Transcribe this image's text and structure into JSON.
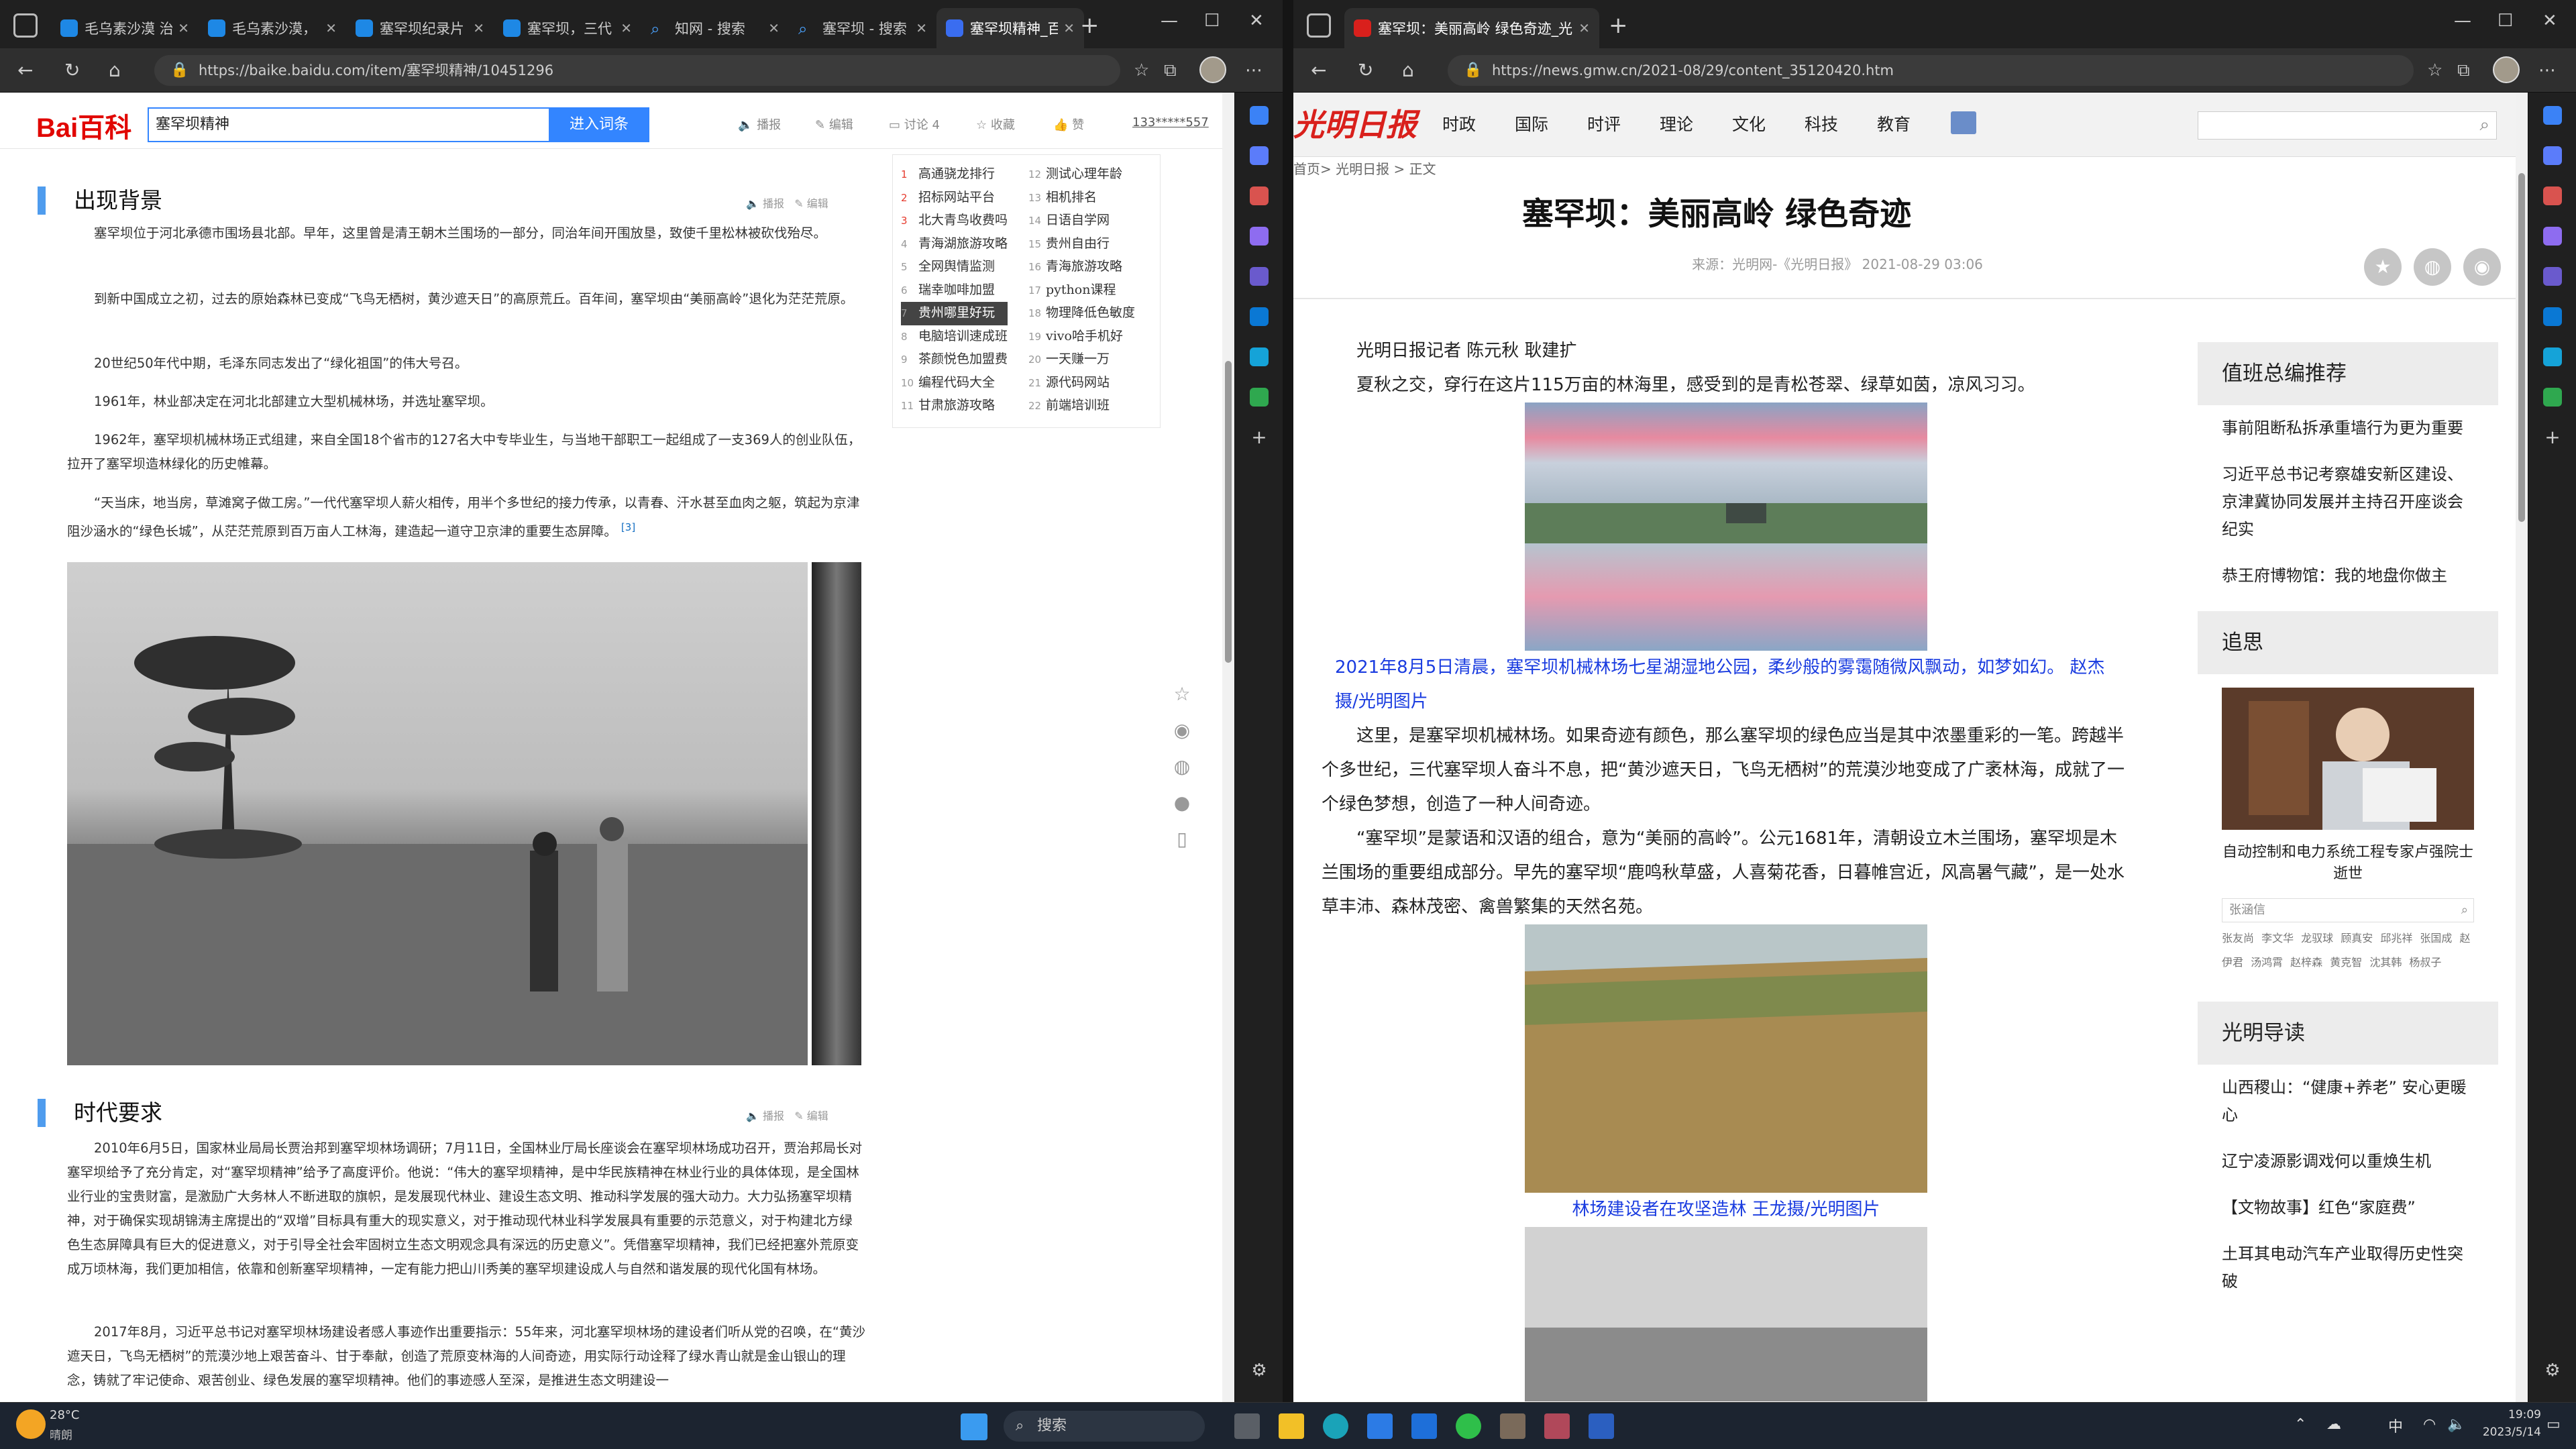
{
  "left": {
    "tabs": [
      "毛乌素沙漠 治",
      "毛乌素沙漠，",
      "塞罕坝纪录片",
      "塞罕坝，三代",
      "知网 - 搜索",
      "塞罕坝 - 搜索",
      "塞罕坝精神_百"
    ],
    "url": "https://baike.baidu.com/item/塞罕坝精神/10451296",
    "logo": "Bai百科",
    "search_value": "塞罕坝精神",
    "enter_button": "进入词条",
    "tools": [
      "播报",
      "编辑",
      "讨论 4",
      "收藏",
      "赞",
      "133*****557"
    ],
    "sec1_title": "出现背景",
    "sec_tool_a": "播报",
    "sec_tool_b": "编辑",
    "p1": "塞罕坝位于河北承德市围场县北部。早年，这里曾是清王朝木兰围场的一部分，同治年间开围放垦，致使千里松林被砍伐殆尽。",
    "p2": "到新中国成立之初，过去的原始森林已变成“飞鸟无栖树，黄沙遮天日”的高原荒丘。百年间，塞罕坝由“美丽高岭”退化为茫茫荒原。",
    "p3": "20世纪50年代中期，毛泽东同志发出了“绿化祖国”的伟大号召。",
    "p4": "1961年，林业部决定在河北北部建立大型机械林场，并选址塞罕坝。",
    "p5": "1962年，塞罕坝机械林场正式组建，来自全国18个省市的127名大中专毕业生，与当地干部职工一起组成了一支369人的创业队伍，拉开了塞罕坝造林绿化的历史帷幕。",
    "p6": "“天当床，地当房，草滩窝子做工房。”一代代塞罕坝人薪火相传，用半个多世纪的接力传承，以青春、汗水甚至血肉之躯，筑起为京津阻沙涵水的“绿色长城”，从茫茫荒原到百万亩人工林海，建造起一道守卫京津的重要生态屏障。",
    "ref": "[3]",
    "sec2_title": "时代要求",
    "p7": "2010年6月5日，国家林业局局长贾治邦到塞罕坝林场调研；7月11日，全国林业厅局长座谈会在塞罕坝林场成功召开，贾治邦局长对塞罕坝给予了充分肯定，对“塞罕坝精神”给予了高度评价。他说：“伟大的塞罕坝精神，是中华民族精神在林业行业的具体体现，是全国林业行业的宝贵财富，是激励广大务林人不断进取的旗帜，是发展现代林业、建设生态文明、推动科学发展的强大动力。大力弘扬塞罕坝精神，对于确保实现胡锦涛主席提出的“双增”目标具有重大的现实意义，对于推动现代林业科学发展具有重要的示范意义，对于构建北方绿色生态屏障具有巨大的促进意义，对于引导全社会牢固树立生态文明观念具有深远的历史意义”。凭借塞罕坝精神，我们已经把塞外荒原变成万顷林海，我们更加相信，依靠和创新塞罕坝精神，一定有能力把山川秀美的塞罕坝建设成人与自然和谐发展的现代化国有林场。",
    "p8": "2017年8月，习近平总书记对塞罕坝林场建设者感人事迹作出重要指示：55年来，河北塞罕坝林场的建设者们听从党的召唤，在“黄沙遮天日，飞鸟无栖树”的荒漠沙地上艰苦奋斗、甘于奉献，创造了荒原变林海的人间奇迹，用实际行动诠释了绿水青山就是金山银山的理念，铸就了牢记使命、艰苦创业、绿色发展的塞罕坝精神。他们的事迹感人至深，是推进生态文明建设一",
    "rank_left": [
      [
        "1",
        "高通骁龙排行"
      ],
      [
        "2",
        "招标网站平台"
      ],
      [
        "3",
        "北大青鸟收费吗"
      ],
      [
        "4",
        "青海湖旅游攻略"
      ],
      [
        "5",
        "全网舆情监测"
      ],
      [
        "6",
        "瑞幸咖啡加盟"
      ],
      [
        "7",
        "贵州哪里好玩"
      ],
      [
        "8",
        "电脑培训速成班"
      ],
      [
        "9",
        "茶颜悦色加盟费"
      ],
      [
        "10",
        "编程代码大全"
      ],
      [
        "11",
        "甘肃旅游攻略"
      ]
    ],
    "rank_right": [
      [
        "12",
        "测试心理年龄"
      ],
      [
        "13",
        "相机排名"
      ],
      [
        "14",
        "日语自学网"
      ],
      [
        "15",
        "贵州自由行"
      ],
      [
        "16",
        "青海旅游攻略"
      ],
      [
        "17",
        "python课程"
      ],
      [
        "18",
        "物理降低色敏度"
      ],
      [
        "19",
        "vivo哈手机好"
      ],
      [
        "20",
        "一天赚一万"
      ],
      [
        "21",
        "源代码网站"
      ],
      [
        "22",
        "前端培训班"
      ]
    ]
  },
  "right": {
    "tab": "塞罕坝：美丽高岭 绿色奇迹_光",
    "url": "https://news.gmw.cn/2021-08/29/content_35120420.htm",
    "logo": "光明日报",
    "nav": [
      "时政",
      "国际",
      "时评",
      "理论",
      "文化",
      "科技",
      "教育"
    ],
    "crumb": "首页> 光明日报 > 正文",
    "title": "塞罕坝：美丽高岭 绿色奇迹",
    "meta": "来源：光明网-《光明日报》   2021-08-29 03:06",
    "byline": "光明日报记者 陈元秋 耿建扩",
    "lead": "夏秋之交，穿行在这片115万亩的林海里，感受到的是青松苍翠、绿草如茵，凉风习习。",
    "cap1": "2021年8月5日清晨，塞罕坝机械林场七星湖湿地公园，柔纱般的雾霭随微风飘动，如梦如幻。 赵杰摄/光明图片",
    "p1": "这里，是塞罕坝机械林场。如果奇迹有颜色，那么塞罕坝的绿色应当是其中浓墨重彩的一笔。跨越半个多世纪，三代塞罕坝人奋斗不息，把“黄沙遮天日，飞鸟无栖树”的荒漠沙地变成了广袤林海，成就了一个绿色梦想，创造了一种人间奇迹。",
    "p2": "“塞罕坝”是蒙语和汉语的组合，意为“美丽的高岭”。公元1681年，清朝设立木兰围场，塞罕坝是木兰围场的重要组成部分。早先的塞罕坝“鹿鸣秋草盛，人喜菊花香，日暮帷宫近，风高暑气藏”，是一处水草丰沛、森林茂密、禽兽繁集的天然名苑。",
    "cap2": "林场建设者在攻坚造林 王龙摄/光明图片",
    "side1_title": "值班总编推荐",
    "side1": [
      "事前阻断私拆承重墙行为更为重要",
      "习近平总书记考察雄安新区建设、京津冀协同发展并主持召开座谈会纪实",
      "恭王府博物馆：我的地盘你做主"
    ],
    "side2_title": "追思",
    "side2_cap": "自动控制和电力系统工程专家卢强院士逝世",
    "side2_search": "张涵信",
    "side2_names": "张友尚 李文华 龙驭球 顾真安 邱兆祥 张国成 赵伊君 汤鸿霄 赵梓森 黄克智 沈其韩 杨叔子",
    "side3_title": "光明导读",
    "side3": [
      "山西稷山：“健康+养老” 安心更暖心",
      "辽宁凌源影调戏何以重焕生机",
      "【文物故事】红色“家庭费”",
      "土耳其电动汽车产业取得历史性突破"
    ]
  },
  "taskbar": {
    "weather_temp": "28°C",
    "weather_desc": "晴朗",
    "search": "搜索",
    "time": "19:09",
    "date": "2023/5/14",
    "ime": "中"
  }
}
